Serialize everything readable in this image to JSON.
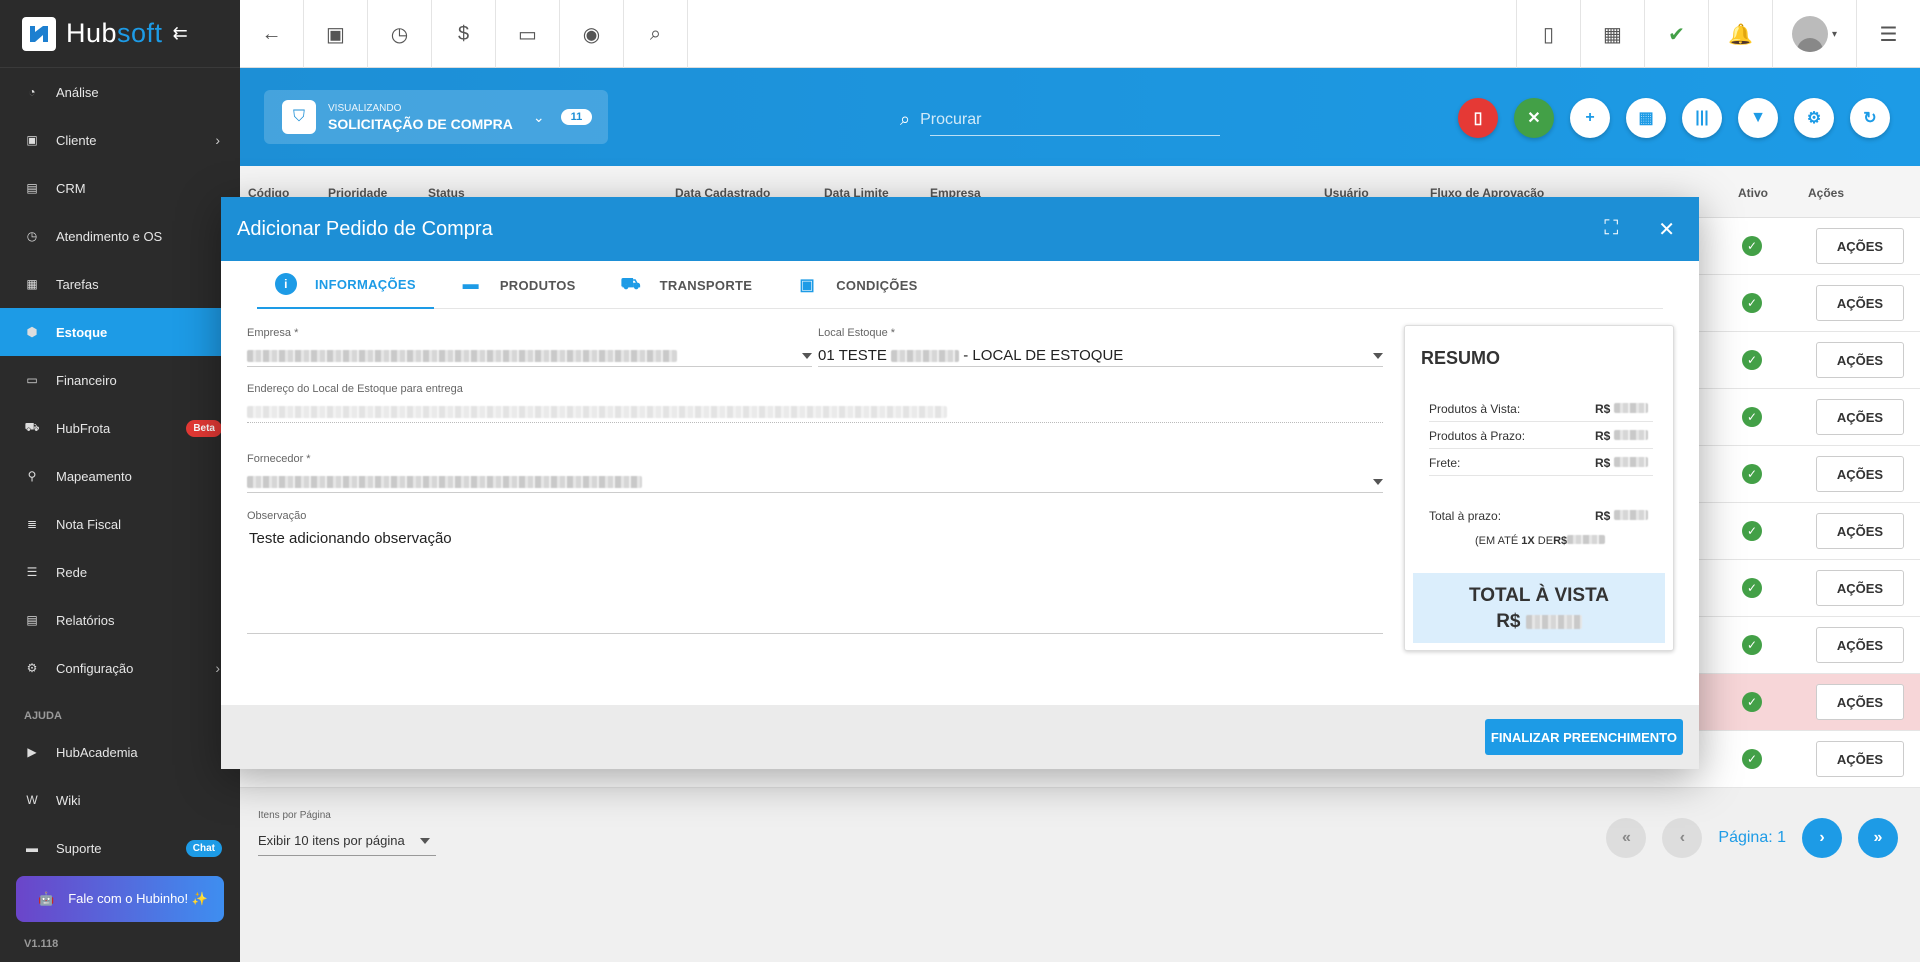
{
  "brand": {
    "name_a": "Hub",
    "name_b": "soft"
  },
  "sidebar": {
    "items": [
      {
        "label": "Análise"
      },
      {
        "label": "Cliente"
      },
      {
        "label": "CRM"
      },
      {
        "label": "Atendimento e OS"
      },
      {
        "label": "Tarefas"
      },
      {
        "label": "Estoque"
      },
      {
        "label": "Financeiro"
      },
      {
        "label": "HubFrota",
        "badge": "Beta"
      },
      {
        "label": "Mapeamento"
      },
      {
        "label": "Nota Fiscal"
      },
      {
        "label": "Rede"
      },
      {
        "label": "Relatórios"
      },
      {
        "label": "Configuração"
      }
    ],
    "section_label": "AJUDA",
    "help_items": [
      {
        "label": "HubAcademia"
      },
      {
        "label": "Wiki"
      },
      {
        "label": "Suporte",
        "badge": "Chat"
      }
    ],
    "hubinho_label": "Fale com o Hubinho! ✨",
    "version": "V1.118"
  },
  "header": {
    "viewing_label": "VISUALIZANDO",
    "viewing_title": "SOLICITAÇÃO DE COMPRA",
    "count": "11",
    "search_placeholder": "Procurar"
  },
  "table": {
    "columns": [
      "Código",
      "Prioridade",
      "Status",
      "Data Cadastrado",
      "Data Limite",
      "Empresa",
      "Usuário",
      "Fluxo de Aprovação",
      "Ativo",
      "Ações"
    ],
    "action_label": "AÇÕES"
  },
  "pagination": {
    "per_page_label": "Itens por Página",
    "per_page_value": "Exibir 10 itens por página",
    "page_text": "Página: 1"
  },
  "modal": {
    "title": "Adicionar Pedido de Compra",
    "tabs": [
      "INFORMAÇÕES",
      "PRODUTOS",
      "TRANSPORTE",
      "CONDIÇÕES"
    ],
    "fields": {
      "empresa_label": "Empresa *",
      "local_label": "Local Estoque *",
      "local_value_a": "01 TESTE",
      "local_value_b": "- LOCAL DE ESTOQUE",
      "endereco_label": "Endereço do Local de Estoque para entrega",
      "fornecedor_label": "Fornecedor *",
      "observacao_label": "Observação",
      "observacao_value": "Teste adicionando observação"
    },
    "resumo": {
      "title": "RESUMO",
      "vista_label": "Produtos à Vista:",
      "prazo_label": "Produtos à Prazo:",
      "frete_label": "Frete:",
      "total_prazo_label": "Total à prazo:",
      "currency": "R$",
      "installments_a": "(EM ATÉ",
      "installments_b": "1X",
      "installments_c": "DE",
      "total_vista_label": "TOTAL À VISTA"
    },
    "footer_button": "FINALIZAR PREENCHIMENTO"
  }
}
